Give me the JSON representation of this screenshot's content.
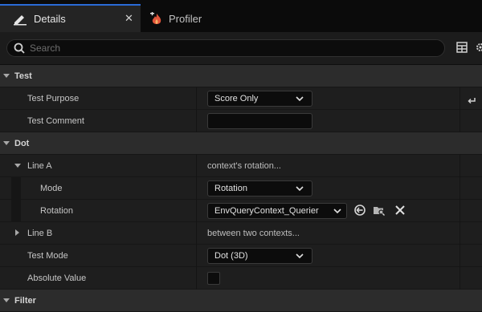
{
  "tabs": [
    {
      "label": "Details",
      "icon": "pencil-icon"
    },
    {
      "label": "Profiler",
      "icon": "flame-icon"
    }
  ],
  "search": {
    "placeholder": "Search"
  },
  "colors": {
    "accent": "#2a6bd6",
    "background": "#1e1e1e",
    "category": "#2c2c2c"
  },
  "rows": {
    "test_category": "Test",
    "test_purpose": {
      "name": "Test Purpose",
      "value": "Score Only"
    },
    "test_comment": {
      "name": "Test Comment",
      "value": ""
    },
    "dot_category": "Dot",
    "line_a": {
      "name": "Line A",
      "value": "context's rotation..."
    },
    "mode": {
      "name": "Mode",
      "value": "Rotation"
    },
    "rotation": {
      "name": "Rotation",
      "value": "EnvQueryContext_Querier"
    },
    "line_b": {
      "name": "Line B",
      "value": "between two contexts..."
    },
    "test_mode": {
      "name": "Test Mode",
      "value": "Dot (3D)"
    },
    "absolute_value": {
      "name": "Absolute Value",
      "checked": false
    },
    "filter_category": "Filter"
  }
}
